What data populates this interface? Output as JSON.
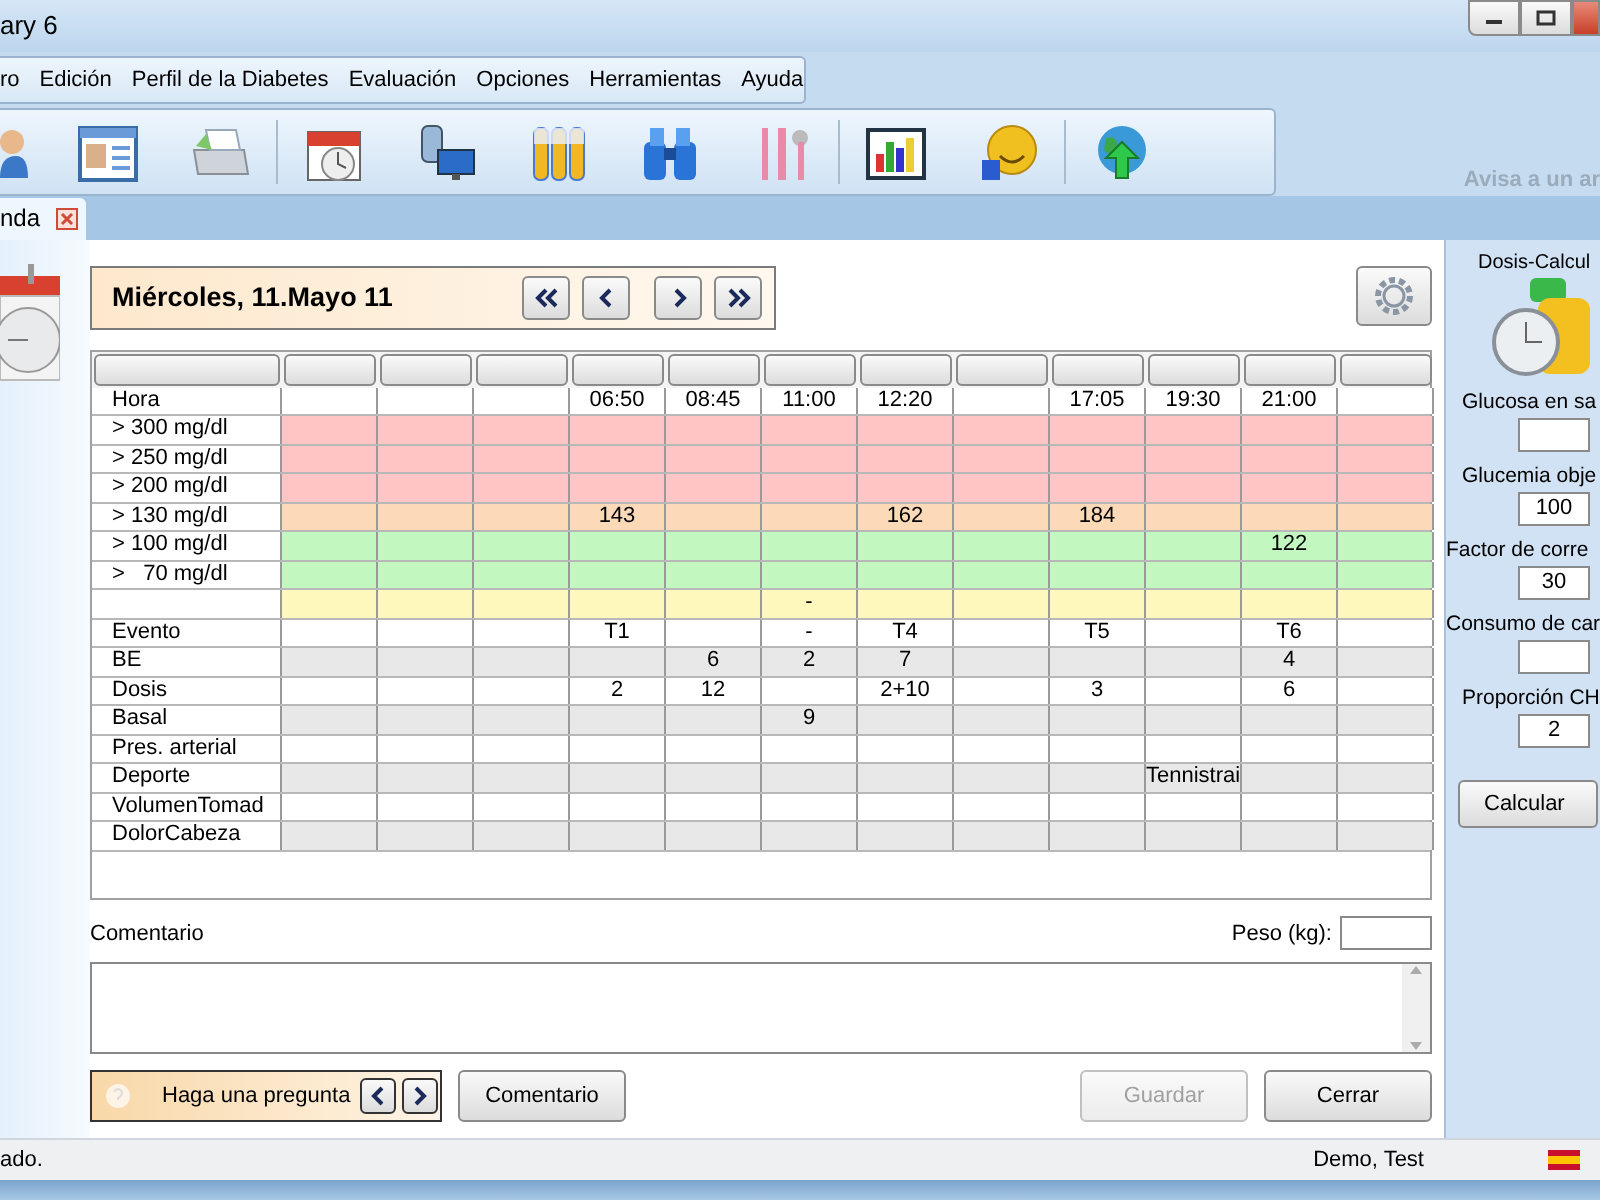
{
  "window": {
    "title": "ary 6"
  },
  "menu": [
    "ro",
    "Edición",
    "Perfil de la Diabetes",
    "Evaluación",
    "Opciones",
    "Herramientas",
    "Ayuda"
  ],
  "toolbar": {
    "notice": "Avisa a un ar"
  },
  "tabs": [
    {
      "label": "nda",
      "selected": true
    }
  ],
  "day": {
    "date": "Miércoles, 11.Mayo 11"
  },
  "table": {
    "rows": [
      {
        "label": "Hora",
        "color": "#ffffff",
        "cells": [
          null,
          null,
          null,
          "06:50",
          "08:45",
          "11:00",
          "12:20",
          null,
          "17:05",
          "19:30",
          "21:00",
          null
        ]
      },
      {
        "label": "> 300 mg/dl",
        "color": "#ffc4c4",
        "cells": [
          null,
          null,
          null,
          null,
          null,
          null,
          null,
          null,
          null,
          null,
          null,
          null
        ]
      },
      {
        "label": "> 250 mg/dl",
        "color": "#ffc4c4",
        "cells": [
          null,
          null,
          null,
          null,
          null,
          null,
          null,
          null,
          null,
          null,
          null,
          null
        ]
      },
      {
        "label": "> 200 mg/dl",
        "color": "#ffc4c4",
        "cells": [
          null,
          null,
          null,
          null,
          null,
          null,
          null,
          null,
          null,
          null,
          null,
          null
        ]
      },
      {
        "label": "> 130 mg/dl",
        "color": "#fcdab8",
        "cells": [
          null,
          null,
          null,
          "143",
          null,
          null,
          "162",
          null,
          "184",
          null,
          null,
          null
        ]
      },
      {
        "label": "> 100 mg/dl",
        "color": "#c2f8c0",
        "cells": [
          null,
          null,
          null,
          null,
          null,
          null,
          null,
          null,
          null,
          null,
          "122",
          null
        ]
      },
      {
        "label": ">   70 mg/dl",
        "color": "#c2f8c0",
        "cells": [
          null,
          null,
          null,
          null,
          null,
          null,
          null,
          null,
          null,
          null,
          null,
          null
        ]
      },
      {
        "label": "",
        "color": "#fff8bc",
        "cells": [
          null,
          null,
          null,
          null,
          null,
          "-",
          null,
          null,
          null,
          null,
          null,
          null
        ]
      },
      {
        "label": "Evento",
        "color": "#ffffff",
        "cells": [
          null,
          null,
          null,
          "T1",
          null,
          "-",
          "T4",
          null,
          "T5",
          null,
          "T6",
          null
        ]
      },
      {
        "label": "BE",
        "color": "#e8e8e8",
        "cells": [
          null,
          null,
          null,
          null,
          "6",
          "2",
          "7",
          null,
          null,
          null,
          "4",
          null
        ]
      },
      {
        "label": "Dosis",
        "color": "#ffffff",
        "cells": [
          null,
          null,
          null,
          "2",
          "12",
          null,
          "2+10",
          null,
          "3",
          null,
          "6",
          null
        ]
      },
      {
        "label": "Basal",
        "color": "#e8e8e8",
        "cells": [
          null,
          null,
          null,
          null,
          null,
          "9",
          null,
          null,
          null,
          null,
          null,
          null
        ]
      },
      {
        "label": "Pres. arterial",
        "color": "#ffffff",
        "cells": [
          null,
          null,
          null,
          null,
          null,
          null,
          null,
          null,
          null,
          null,
          null,
          null
        ]
      },
      {
        "label": "Deporte",
        "color": "#e8e8e8",
        "cells": [
          null,
          null,
          null,
          null,
          null,
          null,
          null,
          null,
          null,
          "Tennistrai",
          null,
          null
        ]
      },
      {
        "label": "VolumenTomad",
        "color": "#ffffff",
        "cells": [
          null,
          null,
          null,
          null,
          null,
          null,
          null,
          null,
          null,
          null,
          null,
          null
        ]
      },
      {
        "label": "DolorCabeza",
        "color": "#e8e8e8",
        "cells": [
          null,
          null,
          null,
          null,
          null,
          null,
          null,
          null,
          null,
          null,
          null,
          null
        ]
      }
    ]
  },
  "comment": {
    "label": "Comentario",
    "weight_label": "Peso (kg):"
  },
  "help": {
    "text": "Haga una pregunta"
  },
  "buttons": [
    {
      "label": "Comentario",
      "disabled": false
    },
    {
      "label": "Guardar",
      "disabled": true
    },
    {
      "label": "Cerrar",
      "disabled": false
    }
  ],
  "calculator": {
    "title": "Dosis-Calcul",
    "fields": [
      {
        "label": "Glucosa en sa"
      },
      {
        "label": "Glucemia obje",
        "value": "100"
      },
      {
        "label": "Factor de corre",
        "value": "30"
      },
      {
        "label": "Consumo de car"
      },
      {
        "label": "Proporción CH",
        "value": "2"
      }
    ],
    "button": "Calcular"
  },
  "status_bar": {
    "left": "ado.",
    "user": "Demo, Test"
  }
}
